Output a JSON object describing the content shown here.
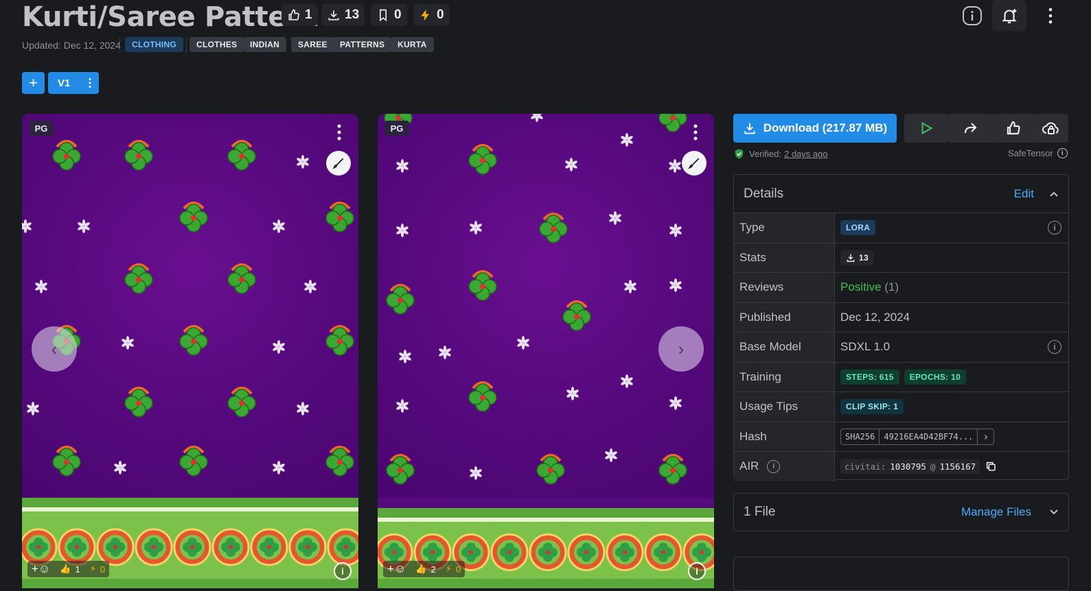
{
  "header": {
    "title": "Kurti/Saree Pattern",
    "stats": [
      {
        "icon": "thumbs-up-icon",
        "value": "1"
      },
      {
        "icon": "download-icon",
        "value": "13"
      },
      {
        "icon": "bookmark-icon",
        "value": "0"
      },
      {
        "icon": "lightning-icon",
        "value": "0"
      }
    ],
    "updated": "Updated: Dec 12, 2024",
    "category": "CLOTHING",
    "tags": [
      "CLOTHES",
      "INDIAN",
      "SAREE",
      "PATTERNS",
      "KURTA"
    ],
    "version_label": "V1",
    "add_symbol": "+"
  },
  "gallery": [
    {
      "rating": "PG",
      "likes": "1",
      "buzz": "0"
    },
    {
      "rating": "PG",
      "likes": "2",
      "buzz": "0"
    }
  ],
  "sidebar": {
    "download_label": "Download (217.87 MB)",
    "verified_prefix": "Verified:",
    "verified_when": "2 days ago",
    "safetensor": "SafeTensor",
    "details_title": "Details",
    "edit_label": "Edit",
    "rows": {
      "type": {
        "key": "Type",
        "value": "LORA"
      },
      "stats": {
        "key": "Stats",
        "value": "13"
      },
      "reviews": {
        "key": "Reviews",
        "value": "Positive",
        "count": "(1)"
      },
      "published": {
        "key": "Published",
        "value": "Dec 12, 2024"
      },
      "base_model": {
        "key": "Base Model",
        "value": "SDXL 1.0"
      },
      "training": {
        "key": "Training",
        "steps": "STEPS: 615",
        "epochs": "EPOCHS: 10"
      },
      "usage": {
        "key": "Usage Tips",
        "value": "CLIP SKIP: 1"
      },
      "hash": {
        "key": "Hash",
        "algo": "SHA256",
        "value": "49216EA4D42BF74..."
      },
      "air": {
        "key": "AIR",
        "prefix": "civitai:",
        "model_id": "1030795",
        "at": "@",
        "version_id": "1156167"
      }
    },
    "files_label": "1 File",
    "manage_files": "Manage Files"
  },
  "colors": {
    "accent": "#228be6",
    "positive": "#40c057",
    "background": "#1a1b1e"
  }
}
